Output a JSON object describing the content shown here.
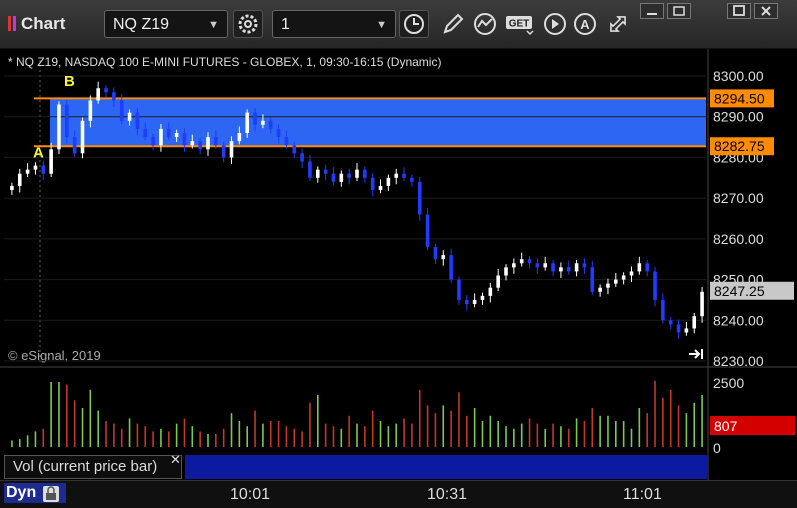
{
  "toolbar": {
    "title": "Chart",
    "symbol": "NQ Z19",
    "interval": "1",
    "icons": [
      "gear-icon",
      "clock-icon",
      "pencil-icon",
      "study-icon",
      "get-icon",
      "play-icon",
      "a-icon",
      "move-icon"
    ],
    "window_icons": [
      "minimize-icon",
      "restore-icon",
      "maximize-icon",
      "close-icon"
    ]
  },
  "chart_data": [
    {
      "type": "candlestick",
      "title": "* NQ Z19, NASDAQ 100 E-MINI FUTURES - GLOBEX, 1, 09:30-16:15 (Dynamic)",
      "copyright": "© eSignal, 2019",
      "y_ticks": [
        "8300.00",
        "8290.00",
        "8280.00",
        "8270.00",
        "8260.00",
        "8250.00",
        "8240.00",
        "8230.00"
      ],
      "y_tick_values": [
        8300,
        8290,
        8280,
        8270,
        8260,
        8250,
        8240,
        8230
      ],
      "ylim": [
        8230,
        8304
      ],
      "x_ticks": [
        "10:01",
        "10:31",
        "11:01"
      ],
      "zone": {
        "high": 8294.5,
        "low": 8282.75,
        "high_label": "8294.50",
        "low_label": "8282.75",
        "color": "#2e6bff"
      },
      "zone_line_color": "#ff8c00",
      "markers": [
        {
          "label": "A",
          "value": 8280
        },
        {
          "label": "B",
          "value": 8297
        }
      ],
      "last_price": {
        "value": 8247.25,
        "label": "8247.25"
      },
      "up_color": "#ffffff",
      "down_color": "#1f3cff",
      "closes": [
        8273,
        8276,
        8277,
        8278,
        8276,
        8282,
        8293,
        8285,
        8281,
        8289,
        8294,
        8297,
        8296,
        8294,
        8289,
        8291,
        8287,
        8285,
        8283,
        8287,
        8285,
        8286,
        8283,
        8284,
        8282,
        8285,
        8283,
        8280,
        8284,
        8286,
        8291,
        8288,
        8289,
        8287,
        8285,
        8283,
        8281,
        8279,
        8275,
        8277,
        8276,
        8274,
        8276,
        8275,
        8277,
        8275,
        8272,
        8273,
        8275,
        8276,
        8275,
        8274,
        8266,
        8258,
        8255,
        8256,
        8250,
        8245,
        8244,
        8245,
        8246,
        8248,
        8251,
        8253,
        8254,
        8255,
        8254,
        8253,
        8254,
        8252,
        8253,
        8252,
        8254,
        8253,
        8247,
        8248,
        8249,
        8250,
        8251,
        8252,
        8254,
        8252,
        8245,
        8240,
        8239,
        8237,
        8238,
        8241,
        8247
      ]
    },
    {
      "type": "bar",
      "title": "Vol (current price bar)",
      "y_ticks": [
        "2500",
        "0"
      ],
      "y_tick_values": [
        2500,
        0
      ],
      "ylim": [
        0,
        2700
      ],
      "last_value": {
        "value": 807,
        "label": "807"
      },
      "up_color": "#7ec850",
      "down_color": "#c0392b",
      "values": [
        250,
        300,
        450,
        600,
        700,
        2500,
        2500,
        2400,
        1800,
        1500,
        2200,
        1400,
        1000,
        900,
        700,
        1100,
        900,
        800,
        600,
        700,
        600,
        900,
        1100,
        800,
        600,
        500,
        500,
        700,
        1300,
        1000,
        800,
        1400,
        900,
        1000,
        1000,
        800,
        700,
        600,
        1700,
        2000,
        900,
        800,
        700,
        1200,
        900,
        800,
        1400,
        1000,
        800,
        900,
        1100,
        900,
        2200,
        1600,
        1300,
        1600,
        1400,
        2100,
        1200,
        1500,
        1000,
        1200,
        1000,
        800,
        700,
        900,
        1100,
        900,
        700,
        900,
        800,
        700,
        1100,
        1000,
        1500,
        1200,
        1200,
        1000,
        1000,
        700,
        1500,
        1300,
        2550,
        1900,
        2200,
        1600,
        1300,
        1700,
        2000
      ]
    }
  ],
  "volume_panel": {
    "label": "Vol (current price bar)"
  },
  "status": {
    "mode": "Dyn",
    "times": [
      "10:01",
      "10:31",
      "11:01"
    ]
  }
}
